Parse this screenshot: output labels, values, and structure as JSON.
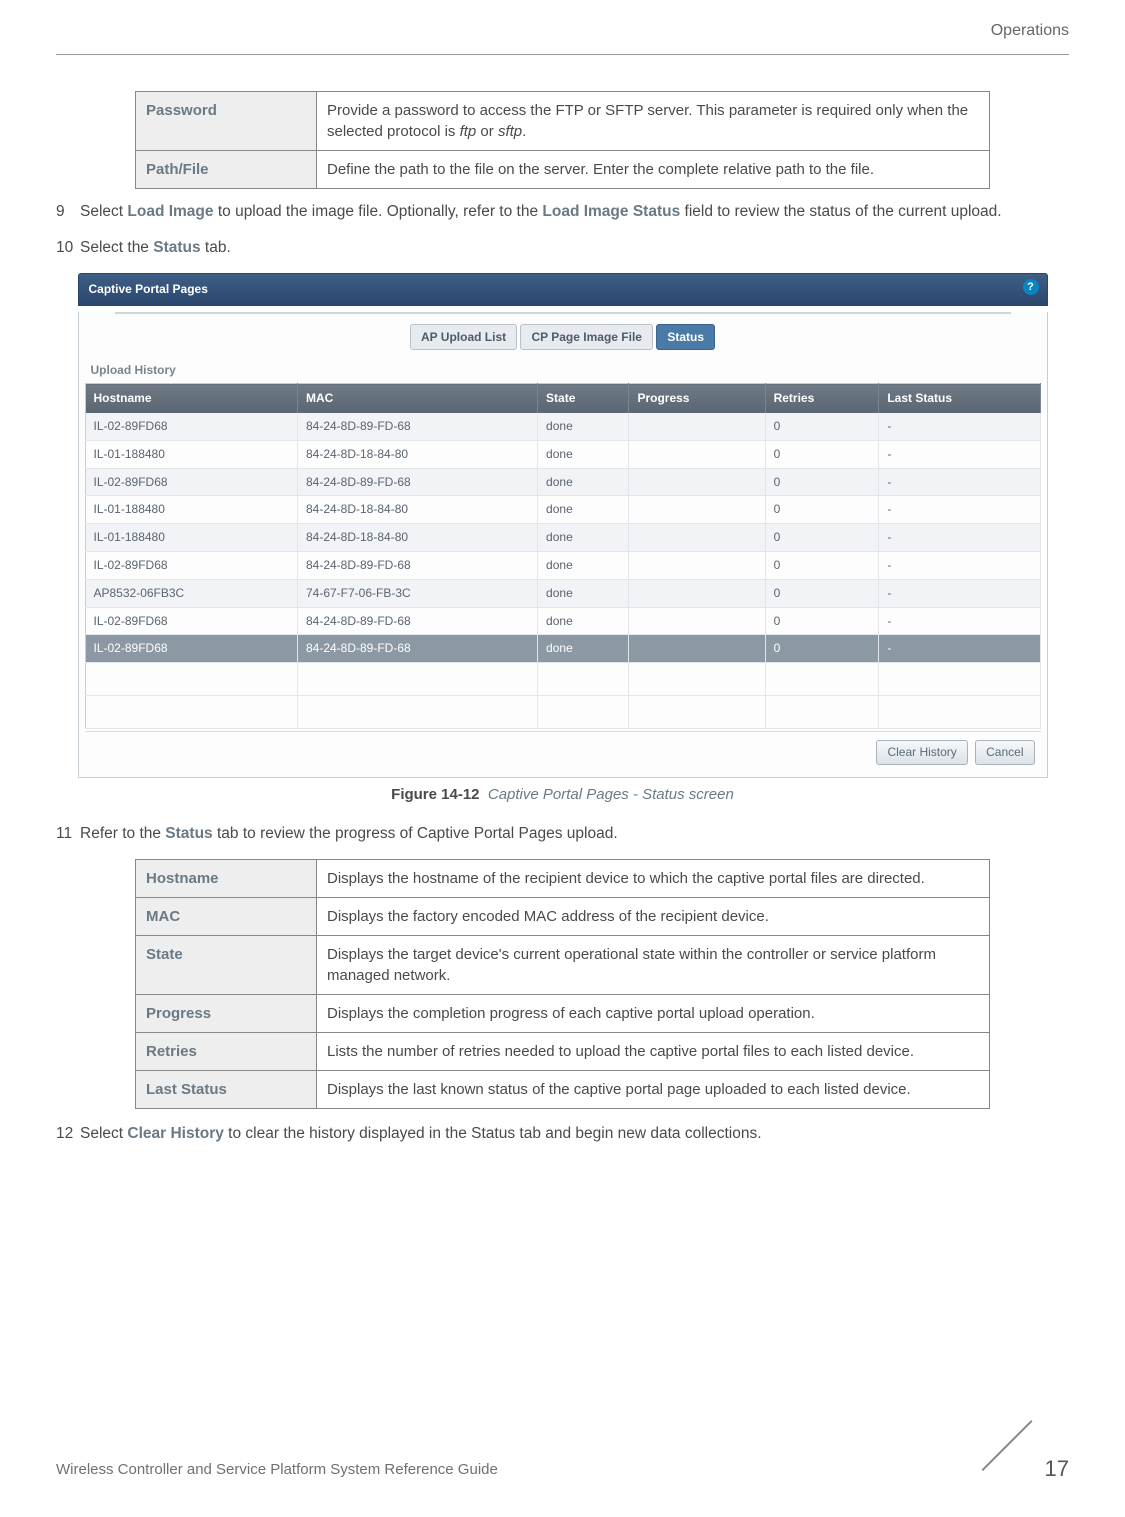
{
  "header": {
    "section": "Operations"
  },
  "param_table": [
    {
      "label": "Password",
      "desc_pre": "Provide a password to access the FTP or SFTP server. This parameter is required only when the selected protocol is ",
      "em1": "ftp",
      "mid": " or ",
      "em2": "sftp",
      "post": "."
    },
    {
      "label": "Path/File",
      "desc": "Define the path to the file on the server. Enter the complete relative path to the file."
    }
  ],
  "steps": {
    "s9_num": "9",
    "s9_a": "Select ",
    "s9_b": "Load Image",
    "s9_c": " to upload the image file. Optionally, refer to the ",
    "s9_d": "Load Image Status",
    "s9_e": " field to review the status of the current upload.",
    "s10_num": "10",
    "s10_a": "Select the ",
    "s10_b": "Status",
    "s10_c": " tab.",
    "s11_num": "11",
    "s11_a": "Refer to the ",
    "s11_b": "Status",
    "s11_c": " tab to review the progress of Captive Portal Pages upload.",
    "s12_num": "12",
    "s12_a": "Select ",
    "s12_b": "Clear History",
    "s12_c": " to clear the history displayed in the Status tab and begin new data collections."
  },
  "shot": {
    "title": "Captive Portal Pages",
    "tabs": {
      "t1": "AP Upload List",
      "t2": "CP Page Image File",
      "t3": "Status"
    },
    "group": "Upload History",
    "cols": {
      "c1": "Hostname",
      "c2": "MAC",
      "c3": "State",
      "c4": "Progress",
      "c5": "Retries",
      "c6": "Last Status"
    },
    "rows": [
      {
        "host": "IL-02-89FD68",
        "mac": "84-24-8D-89-FD-68",
        "state": "done",
        "progress": "",
        "retries": "0",
        "last": "-"
      },
      {
        "host": "IL-01-188480",
        "mac": "84-24-8D-18-84-80",
        "state": "done",
        "progress": "",
        "retries": "0",
        "last": "-"
      },
      {
        "host": "IL-02-89FD68",
        "mac": "84-24-8D-89-FD-68",
        "state": "done",
        "progress": "",
        "retries": "0",
        "last": "-"
      },
      {
        "host": "IL-01-188480",
        "mac": "84-24-8D-18-84-80",
        "state": "done",
        "progress": "",
        "retries": "0",
        "last": "-"
      },
      {
        "host": "IL-01-188480",
        "mac": "84-24-8D-18-84-80",
        "state": "done",
        "progress": "",
        "retries": "0",
        "last": "-"
      },
      {
        "host": "IL-02-89FD68",
        "mac": "84-24-8D-89-FD-68",
        "state": "done",
        "progress": "",
        "retries": "0",
        "last": "-"
      },
      {
        "host": "AP8532-06FB3C",
        "mac": "74-67-F7-06-FB-3C",
        "state": "done",
        "progress": "",
        "retries": "0",
        "last": "-"
      },
      {
        "host": "IL-02-89FD68",
        "mac": "84-24-8D-89-FD-68",
        "state": "done",
        "progress": "",
        "retries": "0",
        "last": "-"
      },
      {
        "host": "IL-02-89FD68",
        "mac": "84-24-8D-89-FD-68",
        "state": "done",
        "progress": "",
        "retries": "0",
        "last": "-"
      }
    ],
    "buttons": {
      "b1": "Clear History",
      "b2": "Cancel"
    }
  },
  "figure": {
    "label": "Figure 14-12",
    "desc": "Captive Portal Pages - Status screen"
  },
  "fields_table": [
    {
      "label": "Hostname",
      "desc": "Displays the hostname of the recipient device to which the captive portal files are directed."
    },
    {
      "label": "MAC",
      "desc": "Displays the factory encoded MAC address of the recipient device."
    },
    {
      "label": "State",
      "desc": "Displays the target device's current operational state within the controller or service platform managed network."
    },
    {
      "label": "Progress",
      "desc": "Displays the completion progress of each captive portal upload operation."
    },
    {
      "label": "Retries",
      "desc": "Lists the number of retries needed to upload the captive portal files to each listed device."
    },
    {
      "label": "Last Status",
      "desc": "Displays the last known status of the captive portal page uploaded to each listed device."
    }
  ],
  "footer": {
    "left": "Wireless Controller and Service Platform System Reference Guide",
    "page": "17"
  }
}
